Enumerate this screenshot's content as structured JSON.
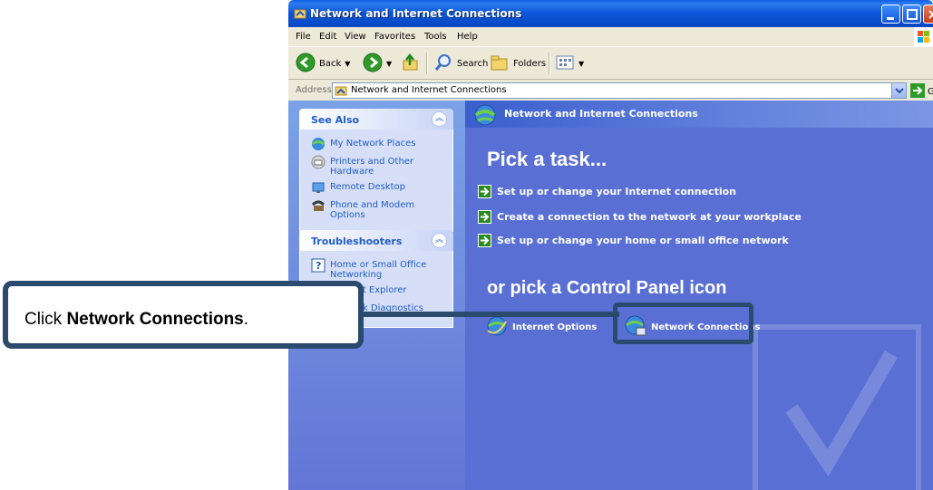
{
  "window": {
    "title": "Network and Internet Connections"
  },
  "menu": {
    "file": "File",
    "edit": "Edit",
    "view": "View",
    "favorites": "Favorites",
    "tools": "Tools",
    "help": "Help"
  },
  "toolbar": {
    "back": "Back",
    "search": "Search",
    "folders": "Folders"
  },
  "address": {
    "label": "Address",
    "value": "Network and Internet Connections",
    "go": "Go"
  },
  "see_also": {
    "title": "See Also",
    "items": [
      {
        "label": "My Network Places",
        "icon": "network-places-icon"
      },
      {
        "label": "Printers and Other Hardware",
        "icon": "printer-icon"
      },
      {
        "label": "Remote Desktop",
        "icon": "remote-desktop-icon"
      },
      {
        "label": "Phone and Modem Options",
        "icon": "phone-icon"
      }
    ]
  },
  "troubleshooters": {
    "title": "Troubleshooters",
    "items": [
      {
        "label": "Home or Small Office Networking",
        "icon": "help-icon"
      },
      {
        "label": "Internet Explorer",
        "icon": "help-icon"
      },
      {
        "label": "Network Diagnostics",
        "icon": "help-icon"
      }
    ]
  },
  "main": {
    "header": "Network and Internet Connections",
    "pick_task": "Pick a task...",
    "tasks": [
      "Set up or change your Internet connection",
      "Create a connection to the network at your workplace",
      "Set up or change your home or small office network"
    ],
    "pick_icon": "or pick a Control Panel icon",
    "icons": [
      {
        "label": "Internet Options",
        "icon": "internet-options-icon"
      },
      {
        "label": "Network Connections",
        "icon": "network-connections-icon"
      }
    ]
  },
  "callout": {
    "prefix": "Click ",
    "bold": "Network Connections",
    "suffix": "."
  },
  "colors": {
    "title_bar": "#0a55d6",
    "left_pane": "#7ba2e7",
    "right_pane": "#5a6fd4",
    "callout_border": "#2a4a6e",
    "link": "#215dc6"
  }
}
